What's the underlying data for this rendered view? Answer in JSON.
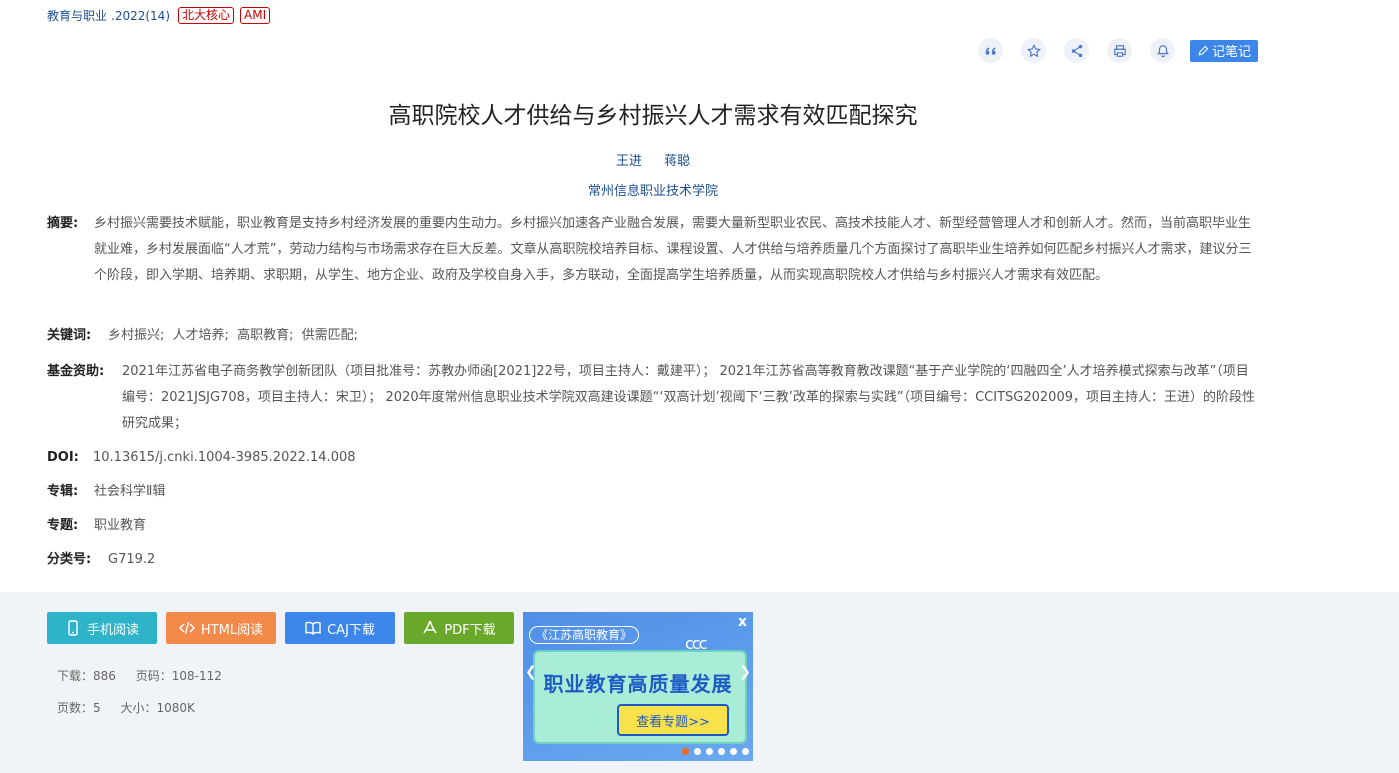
{
  "header": {
    "journal": "教育与职业",
    "issue": ".2022(14)",
    "badges": [
      "北大核心",
      "AMI"
    ]
  },
  "toolbar": {
    "icons": [
      "quote-icon",
      "star-icon",
      "share-icon",
      "print-icon",
      "bell-icon"
    ],
    "note_label": "记笔记"
  },
  "article": {
    "title": "高职院校人才供给与乡村振兴人才需求有效匹配探究",
    "authors": [
      "王进",
      "蒋聪"
    ],
    "institution": "常州信息职业技术学院"
  },
  "meta": {
    "abstract_label": "摘要:",
    "abstract": "乡村振兴需要技术赋能，职业教育是支持乡村经济发展的重要内生动力。乡村振兴加速各产业融合发展，需要大量新型职业农民、高技术技能人才、新型经营管理人才和创新人才。然而，当前高职毕业生就业难，乡村发展面临“人才荒”，劳动力结构与市场需求存在巨大反差。文章从高职院校培养目标、课程设置、人才供给与培养质量几个方面探讨了高职毕业生培养如何匹配乡村振兴人才需求，建议分三个阶段，即入学期、培养期、求职期，从学生、地方企业、政府及学校自身入手，多方联动，全面提高学生培养质量，从而实现高职院校人才供给与乡村振兴人才需求有效匹配。",
    "keywords_label": "关键词:",
    "keywords": [
      "乡村振兴;",
      "人才培养;",
      "高职教育;",
      "供需匹配;"
    ],
    "fund_label": "基金资助:",
    "fund": "2021年江苏省电子商务教学创新团队（项目批准号：苏教办师函[2021]22号，项目主持人：戴建平）； 2021年江苏省高等教育教改课题“基于产业学院的‘四融四全’人才培养模式探索与改革”（项目编号：2021JSJG708，项目主持人：宋卫）； 2020年度常州信息职业技术学院双高建设课题“‘双高计划’视阈下‘三教’改革的探索与实践”（项目编号：CCITSG202009，项目主持人：王进）的阶段性研究成果；",
    "doi_label": "DOI:",
    "doi": "10.13615/j.cnki.1004-3985.2022.14.008",
    "series_label": "专辑:",
    "series": "社会科学Ⅱ辑",
    "topic_label": "专题:",
    "topic": "职业教育",
    "class_label": "分类号:",
    "class": "G719.2"
  },
  "downloads": {
    "buttons": [
      {
        "label": "手机阅读",
        "color": "#2fb3c8"
      },
      {
        "label": "HTML阅读",
        "color": "#f38a4a"
      },
      {
        "label": "CAJ下载",
        "color": "#3b86e8"
      },
      {
        "label": "PDF下载",
        "color": "#6aa82c"
      }
    ],
    "downloads": "下载：886",
    "pages_range": "页码：108-112",
    "page_count": "页数：5",
    "size": "大小：1080K"
  },
  "banner": {
    "tag": "《江苏高职教育》",
    "headline": "职业教育高质量发展",
    "cta": "查看专题>>",
    "close": "x",
    "quote_mark": "ccc"
  }
}
